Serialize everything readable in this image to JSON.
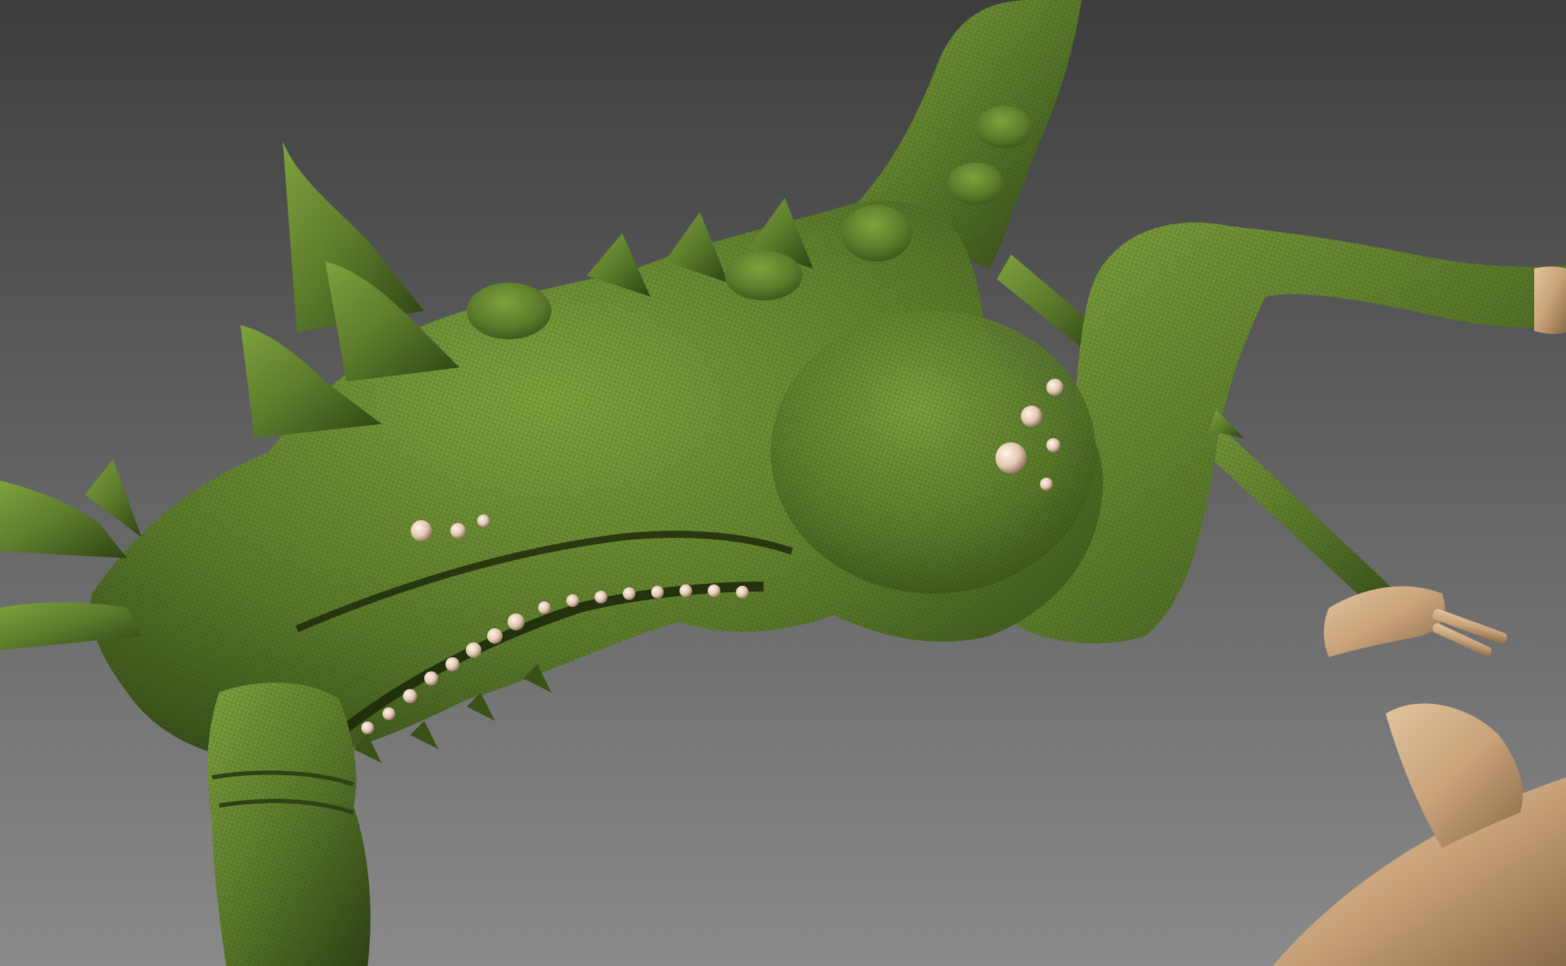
{
  "viewport": {
    "background_top": "#3d3d3d",
    "background_bottom": "#8a8a8a"
  },
  "model": {
    "creature_color": "#5a7a2a",
    "creature_highlight": "#7fa23e",
    "creature_shadow": "#2e4214",
    "accessory_color": "#c8a27a",
    "accessory_shadow": "#8a6a48",
    "bead_color": "#e2c7b0"
  }
}
